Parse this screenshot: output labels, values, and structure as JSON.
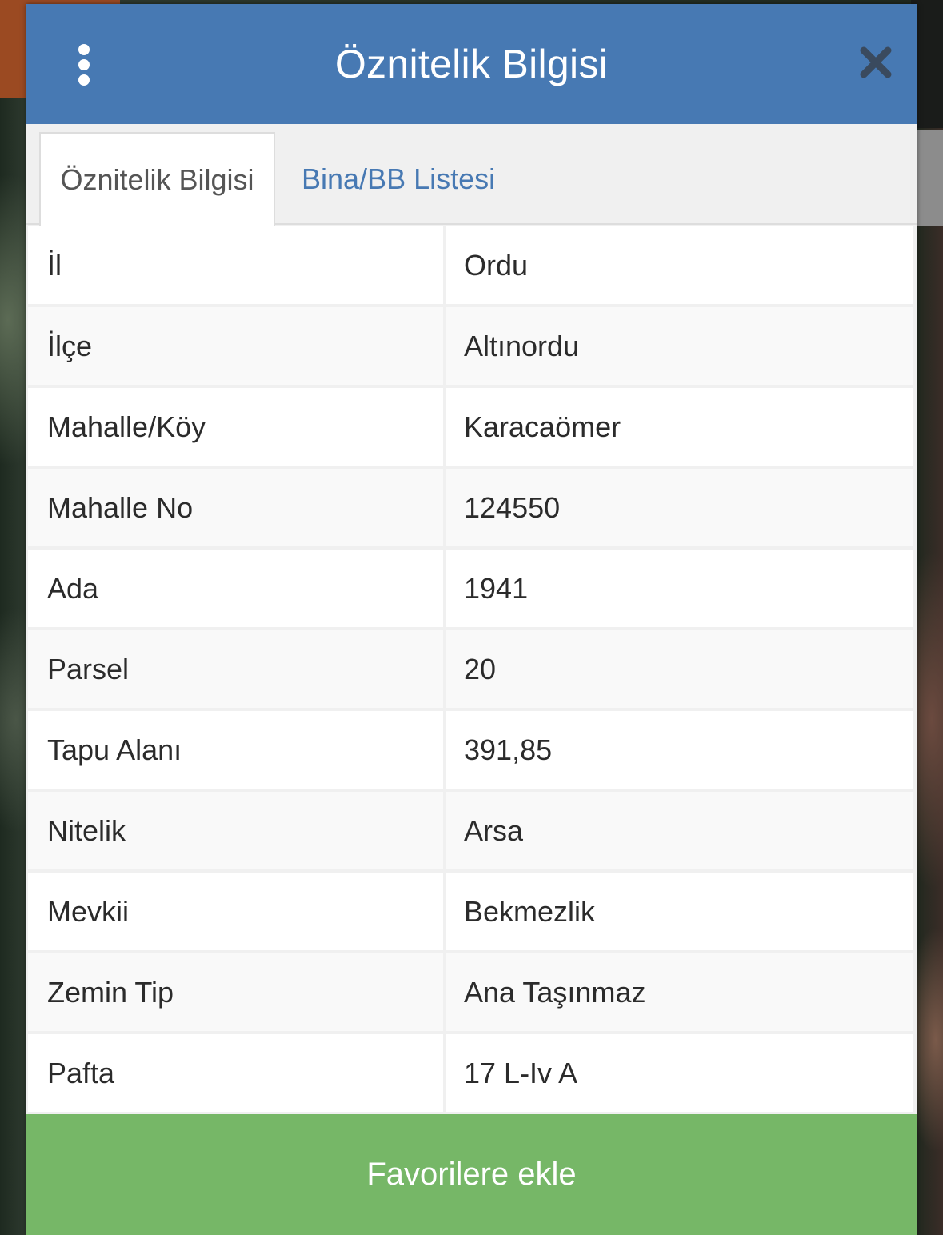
{
  "header": {
    "title": "Öznitelik Bilgisi",
    "menu_icon": "more-vertical-icon",
    "close_icon": "close-icon"
  },
  "tabs": [
    {
      "label": "Öznitelik Bilgisi",
      "active": true
    },
    {
      "label": "Bina/BB Listesi",
      "active": false
    }
  ],
  "attributes": [
    {
      "key": "İl",
      "value": "Ordu"
    },
    {
      "key": "İlçe",
      "value": "Altınordu"
    },
    {
      "key": "Mahalle/Köy",
      "value": "Karacaömer"
    },
    {
      "key": "Mahalle No",
      "value": "124550"
    },
    {
      "key": "Ada",
      "value": "1941"
    },
    {
      "key": "Parsel",
      "value": "20"
    },
    {
      "key": "Tapu Alanı",
      "value": "391,85"
    },
    {
      "key": "Nitelik",
      "value": "Arsa"
    },
    {
      "key": "Mevkii",
      "value": "Bekmezlik"
    },
    {
      "key": "Zemin Tip",
      "value": "Ana Taşınmaz"
    },
    {
      "key": "Pafta",
      "value": "17 L-Iv A"
    }
  ],
  "footer": {
    "favorite_label": "Favorilere ekle"
  },
  "colors": {
    "header": "#4779b3",
    "favorite_button": "#76b767",
    "tab_link": "#4779b3"
  }
}
